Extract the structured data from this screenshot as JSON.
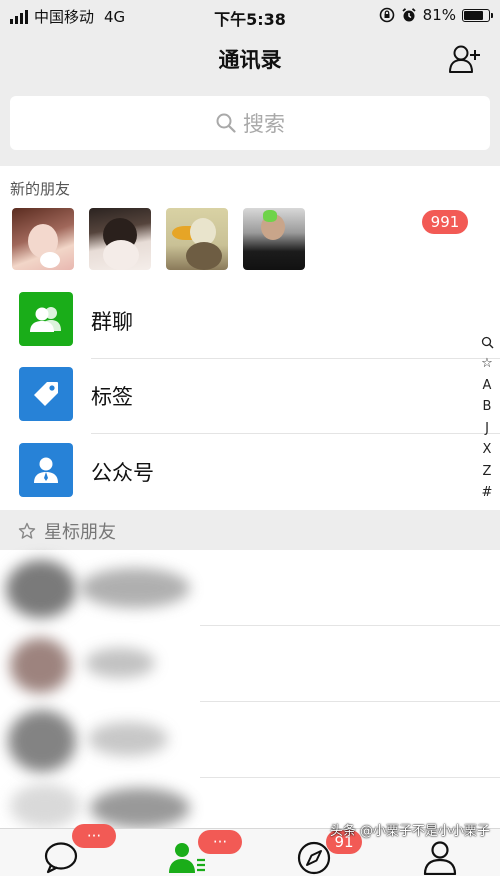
{
  "status": {
    "carrier": "中国移动",
    "network": "4G",
    "time": "下午5:38",
    "battery": "81%",
    "battery_level": 0.81
  },
  "nav": {
    "title": "通讯录"
  },
  "search": {
    "placeholder": "搜索"
  },
  "new_friends": {
    "label": "新的朋友",
    "badge": "991"
  },
  "menu": [
    {
      "label": "群聊",
      "icon": "group-chat-icon",
      "color": "#1aad19"
    },
    {
      "label": "标签",
      "icon": "tag-icon",
      "color": "#2782d7"
    },
    {
      "label": "公众号",
      "icon": "official-account-icon",
      "color": "#2782d7"
    }
  ],
  "index_letters": [
    "☆",
    "A",
    "B",
    "J",
    "X",
    "Z",
    "#"
  ],
  "starred": {
    "label": "星标朋友"
  },
  "tabs": {
    "chat_badge": "···",
    "contacts_badge": "···",
    "discover_badge": "91"
  },
  "watermark": "头条 @小栗子不是小小栗子",
  "colors": {
    "accent_green": "#1aad19",
    "badge_red": "#f25a55",
    "blue_icon": "#2782d7"
  }
}
